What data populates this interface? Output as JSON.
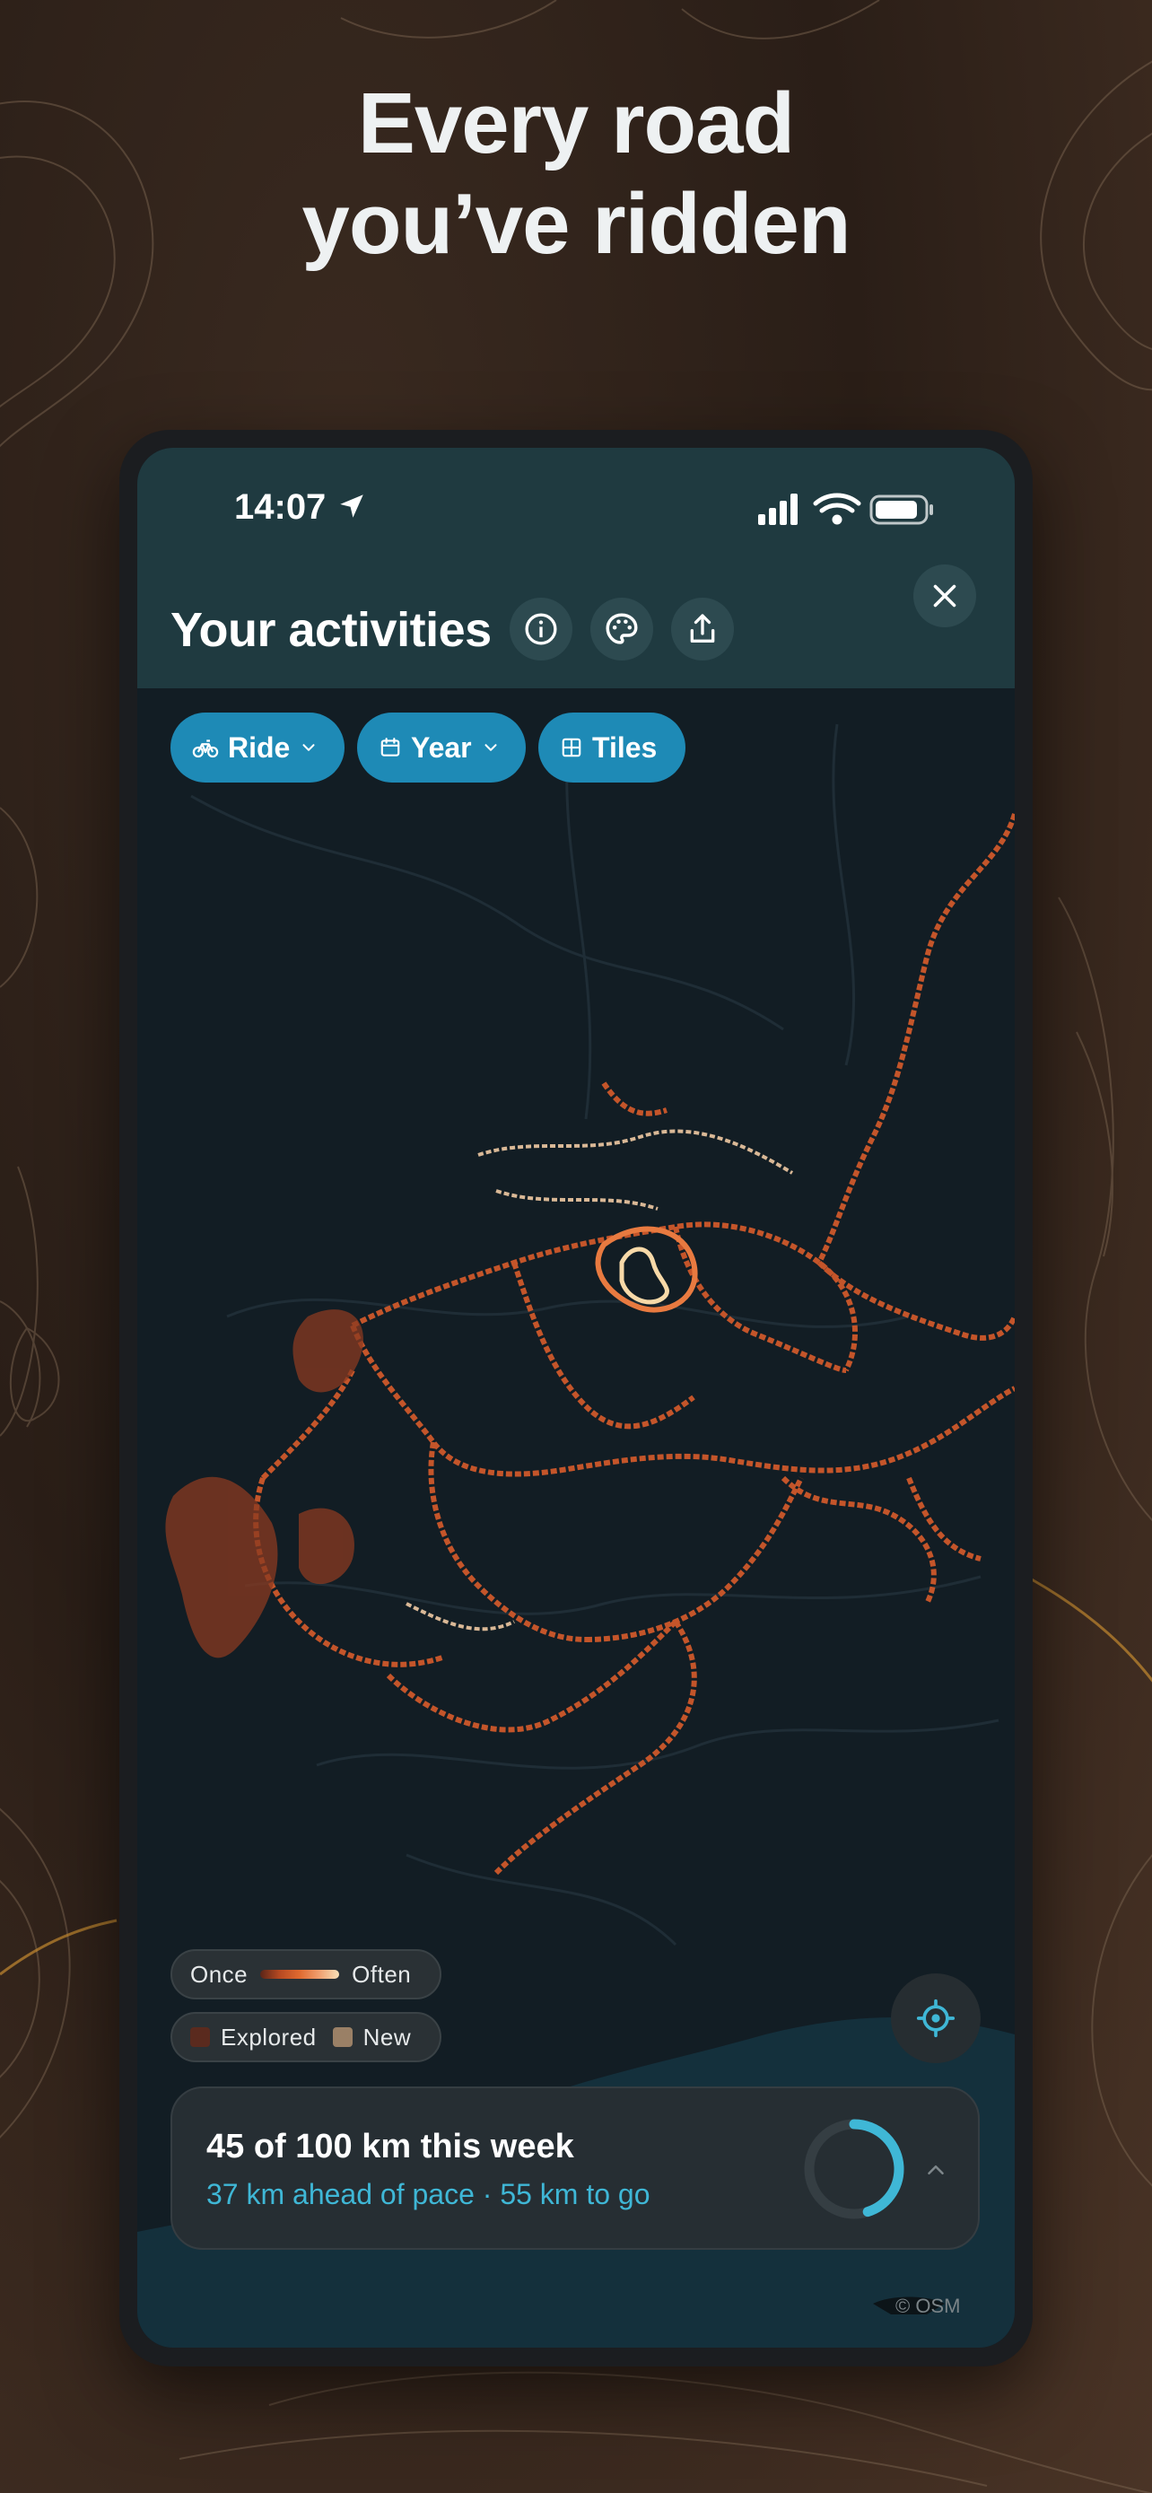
{
  "headline": {
    "line1": "Every road",
    "line2": "you’ve ridden"
  },
  "status_bar": {
    "time": "14:07",
    "icons": [
      "location-arrow-icon",
      "cellular-signal-icon",
      "wifi-icon",
      "battery-icon"
    ]
  },
  "header": {
    "title": "Your activities",
    "buttons": [
      "info-icon",
      "palette-icon",
      "share-icon"
    ],
    "close": "close-icon"
  },
  "filters": [
    {
      "label": "Ride",
      "icon": "bicycle-icon",
      "dropdown": true
    },
    {
      "label": "Year",
      "icon": "calendar-icon",
      "dropdown": true
    },
    {
      "label": "Tiles",
      "icon": "grid-icon",
      "dropdown": false
    }
  ],
  "legend": {
    "frequency_min": "Once",
    "frequency_max": "Often",
    "explored_label": "Explored",
    "new_label": "New",
    "explored_color": "#5a2a1e",
    "new_color": "#9a8066"
  },
  "goal": {
    "title": "45 of 100 km this week",
    "subtitle": "37 km ahead of pace · 55 km to go",
    "progress": 0.45,
    "ring_color": "#3fb7d6"
  },
  "map": {
    "attribution": "© OSM",
    "route_color": "#c4552a",
    "hot_color": "#f7d9a8"
  },
  "colors": {
    "accent": "#1e8ab6",
    "header_bg": "#1f3a40",
    "map_bg": "#101a20"
  }
}
